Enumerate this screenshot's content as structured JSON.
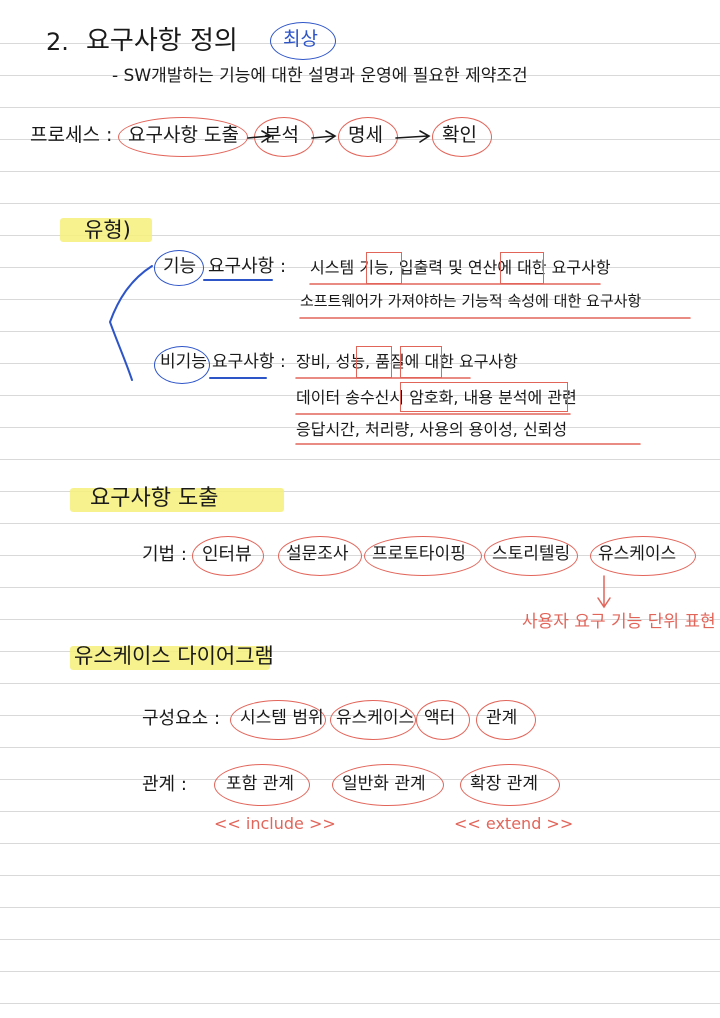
{
  "section_title": {
    "number": "2.",
    "text": "요구사항 정의",
    "badge": "최상"
  },
  "definition": "- SW개발하는 기능에 대한 설명과 운영에 필요한 제약조건",
  "process": {
    "label": "프로세스 :",
    "steps": [
      "요구사항 도출",
      "분석",
      "명세",
      "확인"
    ]
  },
  "types": {
    "heading": "유형)",
    "functional": {
      "label": "기능",
      "suffix": "요구사항 :",
      "line1": "시스템 기능, 입출력 및 연산에 대한 요구사항",
      "line2": "소프트웨어가 가져야하는 기능적 속성에 대한 요구사항"
    },
    "nonfunctional": {
      "label": "비기능",
      "suffix": "요구사항 :",
      "line1": "장비, 성능, 품질에 대한 요구사항",
      "line2": "데이터 송수신시 암호화, 내용 분석에 관련",
      "line3": "응답시간, 처리량, 사용의 용이성, 신뢰성"
    }
  },
  "elicitation": {
    "heading": "요구사항 도출",
    "label": "기법 :",
    "methods": [
      "인터뷰",
      "설문조사",
      "프로토타이핑",
      "스토리텔링",
      "유스케이스"
    ],
    "note": "사용자 요구 기능 단위 표현"
  },
  "usecase": {
    "heading": "유스케이스 다이어그램",
    "components_label": "구성요소 :",
    "components": [
      "시스템 범위",
      "유스케이스",
      "액터",
      "관계"
    ],
    "relations_label": "관계 :",
    "relations": [
      "포함 관계",
      "일반화 관계",
      "확장 관계"
    ],
    "include_tag": "<< include >>",
    "extend_tag": "<< extend >>"
  },
  "colors": {
    "ink": "#1a1a1a",
    "red": "#e2655a",
    "blue": "#2e55c8",
    "highlight": "#f6f07a"
  }
}
